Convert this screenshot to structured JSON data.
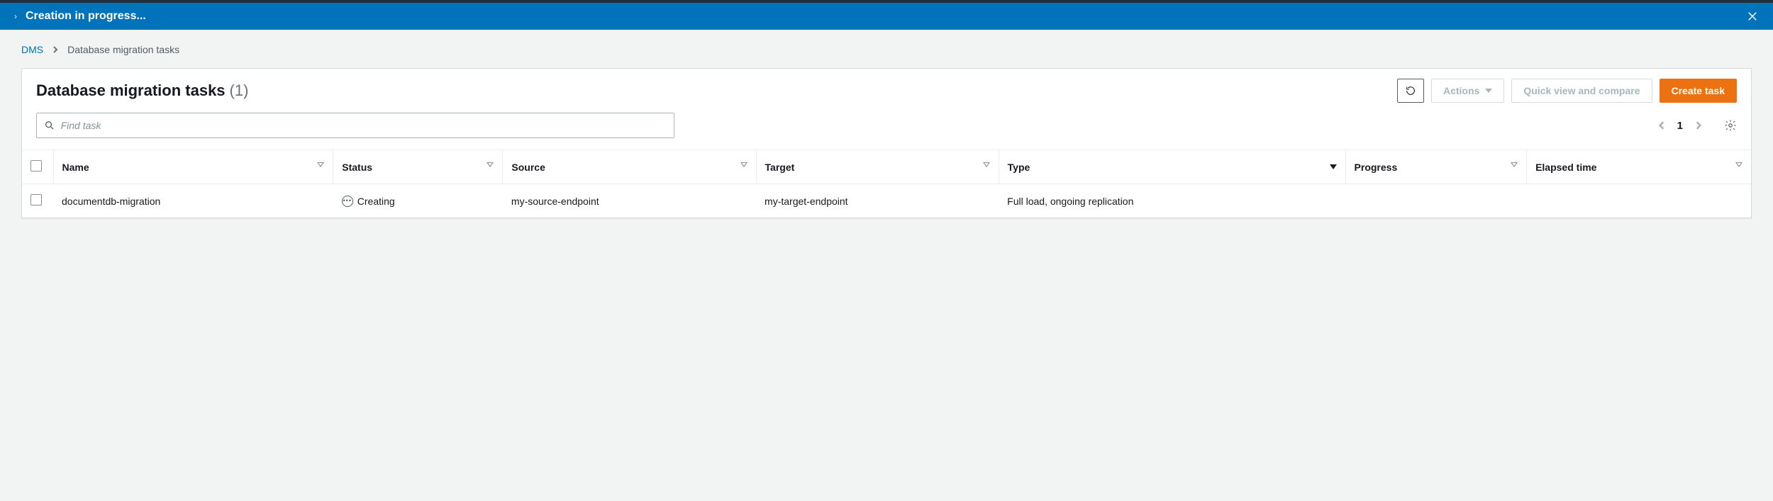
{
  "banner": {
    "text": "Creation in progress..."
  },
  "breadcrumb": {
    "root": "DMS",
    "current": "Database migration tasks"
  },
  "panel": {
    "title": "Database migration tasks",
    "count": "(1)"
  },
  "buttons": {
    "actions": "Actions",
    "quick_view": "Quick view and compare",
    "create": "Create task"
  },
  "search": {
    "placeholder": "Find task"
  },
  "pager": {
    "page": "1"
  },
  "columns": {
    "name": "Name",
    "status": "Status",
    "source": "Source",
    "target": "Target",
    "type": "Type",
    "progress": "Progress",
    "elapsed": "Elapsed time"
  },
  "rows": [
    {
      "name": "documentdb-migration",
      "status": "Creating",
      "source": "my-source-endpoint",
      "target": "my-target-endpoint",
      "type": "Full load, ongoing replication",
      "progress": "",
      "elapsed": ""
    }
  ]
}
